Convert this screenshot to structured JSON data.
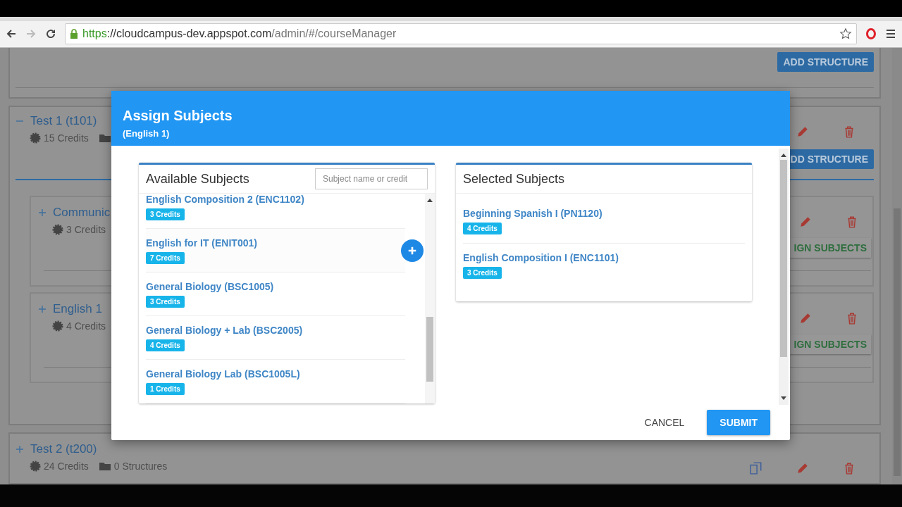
{
  "browser": {
    "url_scheme": "https",
    "url_host": "://cloudcampus-dev.appspot.com",
    "url_path": "/admin/#/courseManager"
  },
  "page": {
    "top_card": {
      "button": "ADD STRUCTURE"
    },
    "structures": [
      {
        "title": "Test 1 (t101)",
        "expanded": true,
        "credits": "15 Credits",
        "button": "DD STRUCTURE",
        "children": [
          {
            "title": "Communic",
            "expanded": false,
            "credits": "3 Credits",
            "button": "IGN SUBJECTS"
          },
          {
            "title": "English 1",
            "expanded": false,
            "credits": "4 Credits",
            "button": "IGN SUBJECTS"
          }
        ]
      },
      {
        "title": "Test 2 (t200)",
        "expanded": false,
        "credits": "24 Credits",
        "structures": "0 Structures"
      }
    ]
  },
  "modal": {
    "title": "Assign Subjects",
    "subtitle": "(English 1)",
    "available": {
      "title": "Available Subjects",
      "placeholder": "Subject name or credit",
      "subjects": [
        {
          "name": "English Composition 2 (ENC1102)",
          "credits": "3 Credits",
          "hovered": false
        },
        {
          "name": "English for IT (ENIT001)",
          "credits": "7 Credits",
          "hovered": true
        },
        {
          "name": "General Biology (BSC1005)",
          "credits": "3 Credits",
          "hovered": false
        },
        {
          "name": "General Biology + Lab (BSC2005)",
          "credits": "4 Credits",
          "hovered": false
        },
        {
          "name": "General Biology Lab (BSC1005L)",
          "credits": "1 Credits",
          "hovered": false
        }
      ]
    },
    "selected": {
      "title": "Selected Subjects",
      "subjects": [
        {
          "name": "Beginning Spanish I (PN1120)",
          "credits": "4 Credits"
        },
        {
          "name": "English Composition I (ENC1101)",
          "credits": "3 Credits"
        }
      ]
    },
    "cancel": "CANCEL",
    "submit": "SUBMIT"
  }
}
